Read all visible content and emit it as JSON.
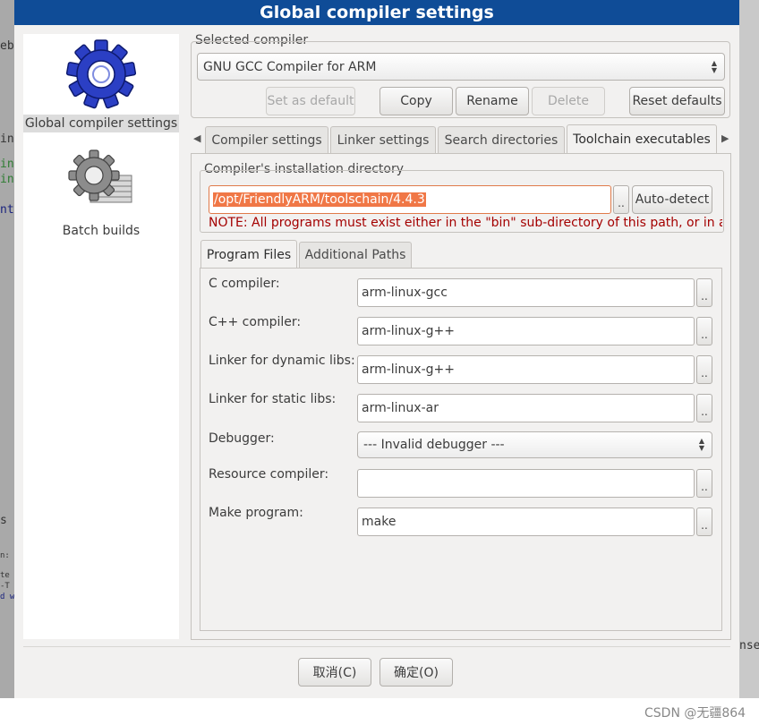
{
  "window": {
    "title": "Global compiler settings"
  },
  "sidebar": {
    "items": [
      {
        "label": "Global compiler settings",
        "icon": "gear-blue-icon",
        "selected": true
      },
      {
        "label": "Batch builds",
        "icon": "gear-gray-stack-icon",
        "selected": false
      }
    ]
  },
  "selected_compiler": {
    "label": "Selected compiler",
    "value": "GNU GCC Compiler for ARM"
  },
  "compiler_buttons": {
    "set_default": "Set as default",
    "copy": "Copy",
    "rename": "Rename",
    "delete": "Delete",
    "reset": "Reset defaults"
  },
  "tabs": [
    "Compiler settings",
    "Linker settings",
    "Search directories",
    "Toolchain executables"
  ],
  "active_tab": "Toolchain executables",
  "install_dir": {
    "label": "Compiler's installation directory",
    "path": "/opt/FriendlyARM/toolschain/4.4.3",
    "browse": "..",
    "auto_detect": "Auto-detect",
    "note": "NOTE: All programs must exist either in the \"bin\" sub-directory of this path, or in any"
  },
  "subtabs": [
    "Program Files",
    "Additional Paths"
  ],
  "active_subtab": "Program Files",
  "programs": [
    {
      "label": "C compiler:",
      "value": "arm-linux-gcc",
      "type": "entry"
    },
    {
      "label": "C++ compiler:",
      "value": "arm-linux-g++",
      "type": "entry"
    },
    {
      "label": "Linker for dynamic libs:",
      "value": "arm-linux-g++",
      "type": "entry"
    },
    {
      "label": "Linker for static libs:",
      "value": "arm-linux-ar",
      "type": "entry"
    },
    {
      "label": "Debugger:",
      "value": "--- Invalid debugger ---",
      "type": "combo"
    },
    {
      "label": "Resource compiler:",
      "value": "",
      "type": "entry"
    },
    {
      "label": "Make program:",
      "value": "make",
      "type": "entry"
    }
  ],
  "browse_label": "..",
  "dialog_buttons": {
    "cancel": "取消(C)",
    "ok": "确定(O)"
  },
  "watermark": "CSDN @无疆864",
  "background_fragments": [
    "ebu",
    "in.",
    "inc",
    "inc",
    "nt",
    "s",
    "n:",
    "te",
    "-T",
    "d w",
    "nse"
  ],
  "colors": {
    "titlebar": "#0f4c97",
    "selection": "#f07746",
    "note": "#a40000"
  }
}
